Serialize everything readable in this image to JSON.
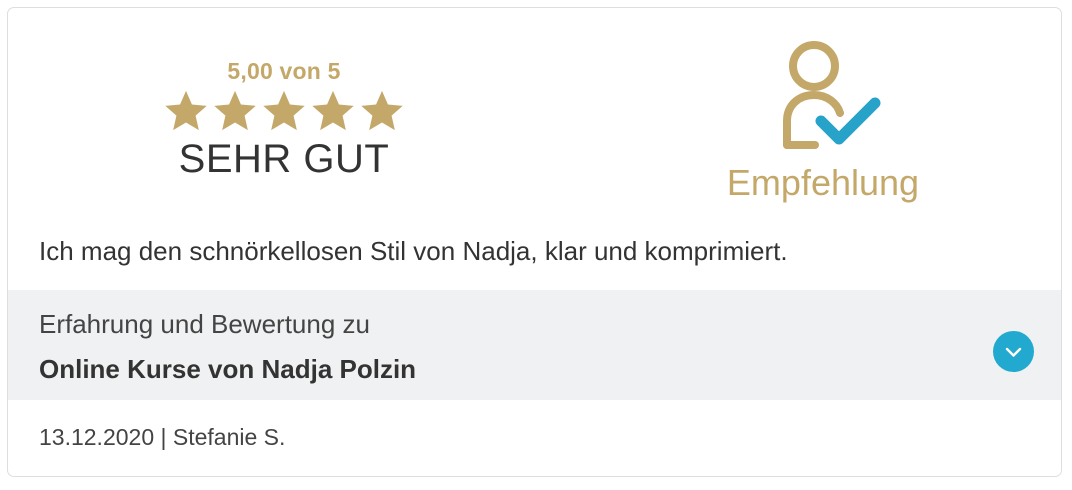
{
  "rating": {
    "score": "5,00 von 5",
    "stars_filled": 5,
    "stars_total": 5,
    "verdict": "SEHR GUT",
    "star_color": "#c4a86a",
    "star-icon": "star-icon"
  },
  "recommendation": {
    "label": "Empfehlung",
    "icon": "person-check-icon",
    "icon_color": "#c4a86a",
    "check_color": "#27a3c9"
  },
  "review": {
    "comment": "Ich mag den schnörkellosen Stil von Nadja, klar und komprimiert."
  },
  "product": {
    "caption": "Erfahrung und Bewertung zu",
    "name": "Online Kurse von Nadja Polzin",
    "expand_icon": "chevron-down-icon",
    "expand_color": "#22a9cf"
  },
  "meta": {
    "date_author": "13.12.2020 | Stefanie S."
  }
}
